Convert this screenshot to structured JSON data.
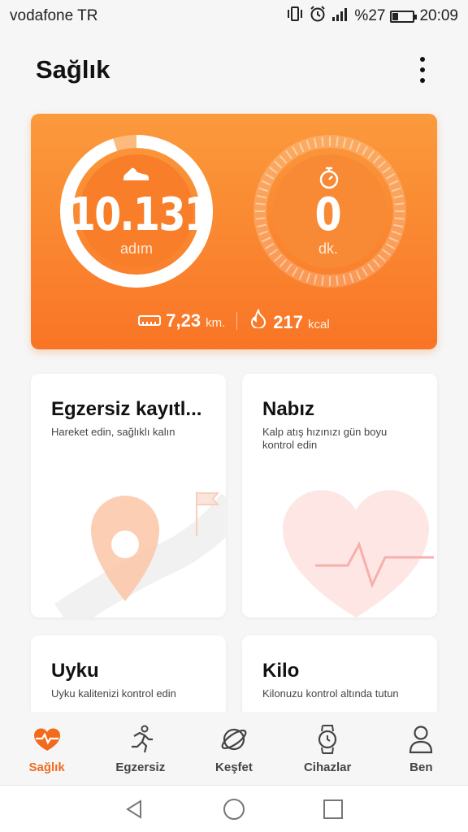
{
  "status_bar": {
    "carrier": "vodafone TR",
    "battery_percent": "%27",
    "time": "20:09",
    "icons": [
      "vibrate-icon",
      "alarm-icon",
      "signal-icon",
      "battery-icon"
    ]
  },
  "header": {
    "title": "Sağlık",
    "menu_icon": "more-vertical-icon"
  },
  "activity": {
    "steps_value": "10.131",
    "steps_unit": "adım",
    "steps_progress": 0.95,
    "time_value": "0",
    "time_unit": "dk.",
    "time_progress": 0,
    "distance_value": "7,23",
    "distance_unit": "km.",
    "calories_value": "217",
    "calories_unit": "kcal",
    "colors": {
      "card_top": "#fb9a3c",
      "card_bottom": "#f97526",
      "accent": "#f26b1d"
    }
  },
  "cards": [
    {
      "title": "Egzersiz kayıtl...",
      "subtitle": "Hareket edin, sağlıklı kalın",
      "icon": "map-pin-route-icon"
    },
    {
      "title": "Nabız",
      "subtitle": "Kalp atış hızınızı gün boyu kontrol edin",
      "icon": "heart-pulse-icon"
    },
    {
      "title": "Uyku",
      "subtitle": "Uyku kalitenizi kontrol edin",
      "icon": "sleep-icon"
    },
    {
      "title": "Kilo",
      "subtitle": "Kilonuzu kontrol altında tutun",
      "icon": "scale-icon"
    }
  ],
  "bottom_nav": [
    {
      "label": "Sağlık",
      "icon": "heart-pulse-icon",
      "active": true
    },
    {
      "label": "Egzersiz",
      "icon": "runner-icon",
      "active": false
    },
    {
      "label": "Keşfet",
      "icon": "planet-icon",
      "active": false
    },
    {
      "label": "Cihazlar",
      "icon": "watch-icon",
      "active": false
    },
    {
      "label": "Ben",
      "icon": "person-icon",
      "active": false
    }
  ],
  "system_nav": [
    "back-icon",
    "home-icon",
    "recents-icon"
  ]
}
